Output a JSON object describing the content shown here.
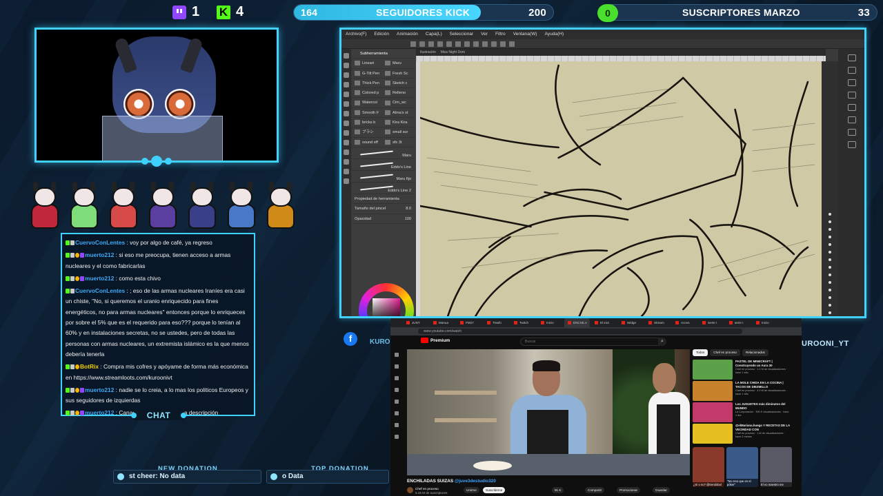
{
  "top": {
    "twitch_count": "1",
    "kick_count": "4",
    "followers_goal": {
      "start": "164",
      "title": "SEGUIDORES KICK",
      "end": "200",
      "progress": 0.72
    },
    "subs_goal": {
      "start": "0",
      "title": "SUSCRIPTORES MARZO",
      "end": "33",
      "progress": 0.0
    }
  },
  "overlay": {
    "chat_label": "CHAT",
    "new_donation_title": "NEW DONATION",
    "new_donation_text": "st cheer: No data",
    "top_donation_title": "TOP DONATION",
    "top_donation_text": "o Data",
    "left_handle": "KURO",
    "right_handle": "UROONI_YT",
    "facebook_icon_glyph": "f"
  },
  "chat": {
    "messages": [
      {
        "user": "CuervoConLentes",
        "color": "#3fa9f5",
        "badges": [
          "k",
          "w"
        ],
        "text": " : voy por algo de café, ya regreso"
      },
      {
        "user": "muerto212",
        "color": "#3fa9f5",
        "badges": [
          "k",
          "w",
          "o",
          "t"
        ],
        "text": " : si eso me preocupa, tienen acceso a armas nucleares y el como fabricarlas"
      },
      {
        "user": "muerto212",
        "color": "#3fa9f5",
        "badges": [
          "k",
          "w",
          "o",
          "t"
        ],
        "text": " : como esta chivo"
      },
      {
        "user": "CuervoConLentes",
        "color": "#3fa9f5",
        "badges": [
          "k",
          "w"
        ],
        "text": " : ; eso de las armas nucleares Iraníes era casi un chiste, \"No, si queremos el uranio enriquecido para fines energéticos, no para armas nucleares\" entonces porque lo enriqueces por sobre el 5% que es el requerido para eso??? porque lo tenían al 60% y en instalaciones secretas, no se ustedes, pero de todas las personas con armas nucleares, un extremista islámico es la que menos debería tenerla"
      },
      {
        "user": "BotRix",
        "color": "#f5d000",
        "badges": [
          "k",
          "w",
          "o"
        ],
        "text": " : Compra mis cofres y apóyame de forma más económica en https://www.streamloots.com/kuroonivt"
      },
      {
        "user": "muerto212",
        "color": "#3fa9f5",
        "badges": [
          "k",
          "w",
          "o",
          "t"
        ],
        "text": " : nadie se lo creia, a lo mas los politicos Europeos y sus seguidores de izquierdas"
      },
      {
        "user": "muerto212",
        "color": "#3fa9f5",
        "badges": [
          "k",
          "w",
          "o",
          "t"
        ],
        "text": " : Canada no entreria en esa descripción"
      }
    ]
  },
  "mascots": [
    {
      "body": "#c0273c"
    },
    {
      "body": "#7fdc7a"
    },
    {
      "body": "#d74a4a"
    },
    {
      "body": "#5a3fa0"
    },
    {
      "body": "#3a3f8a"
    },
    {
      "body": "#4a78c8"
    },
    {
      "body": "#d08a18"
    }
  ],
  "art_app": {
    "menu": [
      "Archivo(F)",
      "Edición",
      "Animación",
      "Capa(L)",
      "Seleccionar",
      "Ver",
      "Filtro",
      "Ventana(W)",
      "Ayuda(H)"
    ],
    "subtool_header": "Subherramienta",
    "tab_label": "Ilustración",
    "doc_tab": "Miss Night Dom",
    "brushes": [
      [
        "Lineart",
        "Maru"
      ],
      [
        "G-Tilt Pen",
        "Fresh Sc"
      ],
      [
        "Thick Pen",
        "Sketch c"
      ],
      [
        "Colored p",
        "Relleno"
      ],
      [
        "Watercol",
        "Cim_wc"
      ],
      [
        "Smooth F",
        "Alma's st"
      ],
      [
        "bricks b",
        "Kira Kira"
      ],
      [
        "ブラシ",
        "small sur"
      ],
      [
        "sound eff",
        "sfx 3t"
      ]
    ],
    "stroke_labels": [
      "Maru",
      "Eddo's Line",
      "Maru fijo",
      "Eddo's Line 2"
    ],
    "prop_label": "Propiedad de herramienta",
    "size_label": "Tamaño del pincel",
    "size_value": "8.0",
    "opacity_label": "Opacidad",
    "opacity_value": "100"
  },
  "browser": {
    "tabs": [
      "JUNT",
      "Manua",
      "FM27",
      "Trasfo",
      "Twitch",
      "Inicio",
      "ENCHILA",
      "El inici",
      "Widge",
      "Stream",
      "Acces",
      "Serie I",
      "serie I",
      "Inicio"
    ],
    "active_tab_index": 6,
    "url": "www.youtube.com/watch",
    "yt_logo": "Premium",
    "search_placeholder": "Buscar",
    "video_title": "ENCHILADAS SUIZAS",
    "video_tag": "@juve3destudio320",
    "channel_name": "Chef en proceso",
    "channel_subs": "5.26 M de suscriptores",
    "join_label": "Unirme",
    "subscribe_label": "Suscribirme",
    "likes": "91 K",
    "share_label": "Compartir",
    "promote_label": "Promocionar",
    "save_label": "Guardar",
    "chips": [
      "Todos",
      "Chef en proceso",
      "Relacionados"
    ],
    "recommended": [
      {
        "title": "PASTEL DE MINECRAFT | Construyendo un Aura 30",
        "meta": "Chef en proceso · 1.2 M de visualizaciones · hace 1 año",
        "color": "#5da04a"
      },
      {
        "title": "LA MOLE CHIDA EN LA COCINA | TACOS DE DIEZMILLO",
        "meta": "Chef en proceso · 4.9 M de visualizaciones · hace 1 año",
        "color": "#c8822c"
      },
      {
        "title": "Los JUGUETES más diminutos del MUNDO",
        "meta": "La Corporación · 300 K visualizaciones · hace 1 día",
        "color": "#c23a6a"
      },
      {
        "title": "@elMariana.huego Y RECETAS DE LA VECINDAD CON",
        "meta": "Chef en proceso · 1 M de visualizaciones · hace 2 meses",
        "color": "#e4c020"
      }
    ],
    "shorts": [
      {
        "title": "¿Si o no? @trendobol",
        "color": "#8a3a2a"
      },
      {
        "title": "\"No creo que en el póker\"",
        "color": "#3a5a8a"
      },
      {
        "title": "El no maestro me",
        "color": "#5a5a66"
      }
    ]
  }
}
